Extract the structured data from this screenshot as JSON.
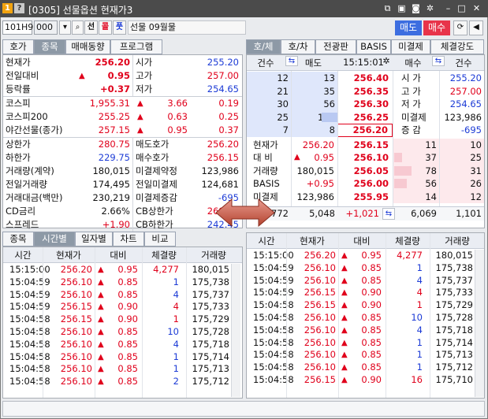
{
  "window": {
    "num_badge": "1",
    "help_badge": "?",
    "title": "[0305] 선물옵션 현재가3"
  },
  "toolbar": {
    "code": "101H9",
    "account": "000",
    "sel1": "선",
    "sel2": "콜",
    "sel3": "풋",
    "product": "선물 09월물",
    "sell_btn": "매도",
    "buy_btn": "매수"
  },
  "left_tabs": [
    "호가",
    "종목",
    "매매동향",
    "프로그램"
  ],
  "right_tabs": [
    "호/체",
    "호/차",
    "전광판",
    "BASIS",
    "미결제",
    "체결강도"
  ],
  "summary": [
    {
      "label": "현재가",
      "val": "256.20",
      "val_color": "red",
      "label2": "시가",
      "val2": "255.20",
      "val2_color": "blue"
    },
    {
      "label": "전일대비",
      "arrow": "▲",
      "val": "0.95",
      "val_color": "red",
      "label2": "고가",
      "val2": "257.00",
      "val2_color": "red"
    },
    {
      "label": "등락률",
      "val": "+0.37",
      "val_color": "red",
      "label2": "저가",
      "val2": "254.65",
      "val2_color": "blue"
    }
  ],
  "index_rows": [
    {
      "label": "코스피",
      "val": "1,955.31",
      "arrow": "▲",
      "chg": "3.66",
      "pct": "0.19"
    },
    {
      "label": "코스피200",
      "val": "255.25",
      "arrow": "▲",
      "chg": "0.63",
      "pct": "0.25"
    },
    {
      "label": "야간선물(종가)",
      "val": "257.15",
      "arrow": "▲",
      "chg": "0.95",
      "pct": "0.37"
    }
  ],
  "detail_rows": [
    {
      "label": "상한가",
      "val": "280.75",
      "val_color": "red",
      "label2": "매도호가",
      "val2": "256.20",
      "val2_color": "red"
    },
    {
      "label": "하한가",
      "val": "229.75",
      "val_color": "blue",
      "label2": "매수호가",
      "val2": "256.15",
      "val2_color": "red"
    },
    {
      "label": "거래량(계약)",
      "val": "180,015",
      "val_color": "black",
      "label2": "미결제약정",
      "val2": "123,986",
      "val2_color": "black"
    },
    {
      "label": "전일거래량",
      "val": "174,495",
      "val_color": "black",
      "label2": "전일미결제",
      "val2": "124,681",
      "val2_color": "black"
    },
    {
      "label": "거래대금(백만)",
      "val": "230,219",
      "val_color": "black",
      "label2": "미결제증감",
      "val2": "-695",
      "val2_color": "blue"
    },
    {
      "label": "CD금리",
      "val": "2.66%",
      "val_color": "black",
      "label2": "CB상한가",
      "val2": "269.00",
      "val2_color": "red"
    },
    {
      "label": "스프레드",
      "val": "+1.90",
      "val_color": "red",
      "label2": "CB하한가",
      "val2": "242.45",
      "val2_color": "blue"
    }
  ],
  "orderbook": {
    "headers": [
      "건수",
      "매도",
      "15:15:01",
      "매수",
      "건수"
    ],
    "ask_rows": [
      {
        "cnt": "12",
        "qty": "13",
        "price": "256.40",
        "info_label": "시  가",
        "info_val": "255.20",
        "info_color": "blue"
      },
      {
        "cnt": "21",
        "qty": "35",
        "price": "256.35",
        "info_label": "고  가",
        "info_val": "257.00",
        "info_color": "red"
      },
      {
        "cnt": "30",
        "qty": "56",
        "price": "256.30",
        "info_label": "저  가",
        "info_val": "254.65",
        "info_color": "blue"
      },
      {
        "cnt": "25",
        "qty": "155",
        "price": "256.25",
        "info_label": "미결제",
        "info_val": "123,986",
        "info_color": "black"
      },
      {
        "cnt": "7",
        "qty": "8",
        "price": "256.20",
        "info_label": "증  감",
        "info_val": "-695",
        "info_color": "blue"
      }
    ],
    "bid_rows": [
      {
        "info_label": "현재가",
        "info_val": "256.20",
        "info_arrow": "",
        "info_color": "red",
        "price": "256.15",
        "qty": "11",
        "cnt": "10"
      },
      {
        "info_label": "대  비",
        "info_val": "0.95",
        "info_arrow": "▲",
        "info_color": "red",
        "price": "256.10",
        "qty": "37",
        "cnt": "25"
      },
      {
        "info_label": "거래량",
        "info_val": "180,015",
        "info_arrow": "",
        "info_color": "black",
        "price": "256.05",
        "qty": "78",
        "cnt": "31"
      },
      {
        "info_label": "BASIS",
        "info_val": "+0.95",
        "info_arrow": "",
        "info_color": "red",
        "price": "256.00",
        "qty": "56",
        "cnt": "26"
      },
      {
        "info_label": "미결제",
        "info_val": "123,986",
        "info_arrow": "",
        "info_color": "black",
        "price": "255.95",
        "qty": "14",
        "cnt": "12"
      }
    ],
    "totals": {
      "ask_cnt": "772",
      "ask_qty": "5,048",
      "diff": "+1,021",
      "bid_qty": "6,069",
      "bid_cnt": "1,101"
    }
  },
  "bottom_tabs": [
    "종목",
    "시간별",
    "일자별",
    "차트",
    "비교"
  ],
  "tick_headers": [
    "시간",
    "현재가",
    "대비",
    "체결량",
    "거래량"
  ],
  "ticks_left": [
    {
      "time": "15:15:00",
      "price": "256.20",
      "arrow": "▲",
      "chg": "0.95",
      "vol": "4,277",
      "vol_color": "red",
      "total": "180,015"
    },
    {
      "time": "15:04:59",
      "price": "256.10",
      "arrow": "▲",
      "chg": "0.85",
      "vol": "1",
      "vol_color": "blue",
      "total": "175,738"
    },
    {
      "time": "15:04:59",
      "price": "256.10",
      "arrow": "▲",
      "chg": "0.85",
      "vol": "4",
      "vol_color": "blue",
      "total": "175,737"
    },
    {
      "time": "15:04:59",
      "price": "256.15",
      "arrow": "▲",
      "chg": "0.90",
      "vol": "4",
      "vol_color": "red",
      "total": "175,733"
    },
    {
      "time": "15:04:58",
      "price": "256.15",
      "arrow": "▲",
      "chg": "0.90",
      "vol": "1",
      "vol_color": "red",
      "total": "175,729"
    },
    {
      "time": "15:04:58",
      "price": "256.10",
      "arrow": "▲",
      "chg": "0.85",
      "vol": "10",
      "vol_color": "blue",
      "total": "175,728"
    },
    {
      "time": "15:04:58",
      "price": "256.10",
      "arrow": "▲",
      "chg": "0.85",
      "vol": "4",
      "vol_color": "blue",
      "total": "175,718"
    },
    {
      "time": "15:04:58",
      "price": "256.10",
      "arrow": "▲",
      "chg": "0.85",
      "vol": "1",
      "vol_color": "blue",
      "total": "175,714"
    },
    {
      "time": "15:04:58",
      "price": "256.10",
      "arrow": "▲",
      "chg": "0.85",
      "vol": "1",
      "vol_color": "blue",
      "total": "175,713"
    },
    {
      "time": "15:04:58",
      "price": "256.10",
      "arrow": "▲",
      "chg": "0.85",
      "vol": "2",
      "vol_color": "blue",
      "total": "175,712"
    }
  ],
  "ticks_right": [
    {
      "time": "15:15:00",
      "price": "256.20",
      "arrow": "▲",
      "chg": "0.95",
      "vol": "4,277",
      "vol_color": "red",
      "total": "180,015"
    },
    {
      "time": "15:04:59",
      "price": "256.10",
      "arrow": "▲",
      "chg": "0.85",
      "vol": "1",
      "vol_color": "blue",
      "total": "175,738"
    },
    {
      "time": "15:04:59",
      "price": "256.10",
      "arrow": "▲",
      "chg": "0.85",
      "vol": "4",
      "vol_color": "blue",
      "total": "175,737"
    },
    {
      "time": "15:04:59",
      "price": "256.15",
      "arrow": "▲",
      "chg": "0.90",
      "vol": "4",
      "vol_color": "red",
      "total": "175,733"
    },
    {
      "time": "15:04:58",
      "price": "256.15",
      "arrow": "▲",
      "chg": "0.90",
      "vol": "1",
      "vol_color": "red",
      "total": "175,729"
    },
    {
      "time": "15:04:58",
      "price": "256.10",
      "arrow": "▲",
      "chg": "0.85",
      "vol": "10",
      "vol_color": "blue",
      "total": "175,728"
    },
    {
      "time": "15:04:58",
      "price": "256.10",
      "arrow": "▲",
      "chg": "0.85",
      "vol": "4",
      "vol_color": "blue",
      "total": "175,718"
    },
    {
      "time": "15:04:58",
      "price": "256.10",
      "arrow": "▲",
      "chg": "0.85",
      "vol": "1",
      "vol_color": "blue",
      "total": "175,714"
    },
    {
      "time": "15:04:58",
      "price": "256.10",
      "arrow": "▲",
      "chg": "0.85",
      "vol": "1",
      "vol_color": "blue",
      "total": "175,713"
    },
    {
      "time": "15:04:58",
      "price": "256.10",
      "arrow": "▲",
      "chg": "0.85",
      "vol": "1",
      "vol_color": "blue",
      "total": "175,712"
    },
    {
      "time": "15:04:58",
      "price": "256.15",
      "arrow": "▲",
      "chg": "0.90",
      "vol": "16",
      "vol_color": "red",
      "total": "175,710"
    }
  ],
  "colors": {
    "up": "#e0001b",
    "down": "#1c3bd6",
    "title_bg": "#4b4b4b",
    "header_bg": "#eaedf3",
    "ask_bg": "#dfe7fb",
    "bid_bg": "#fde9ec"
  }
}
